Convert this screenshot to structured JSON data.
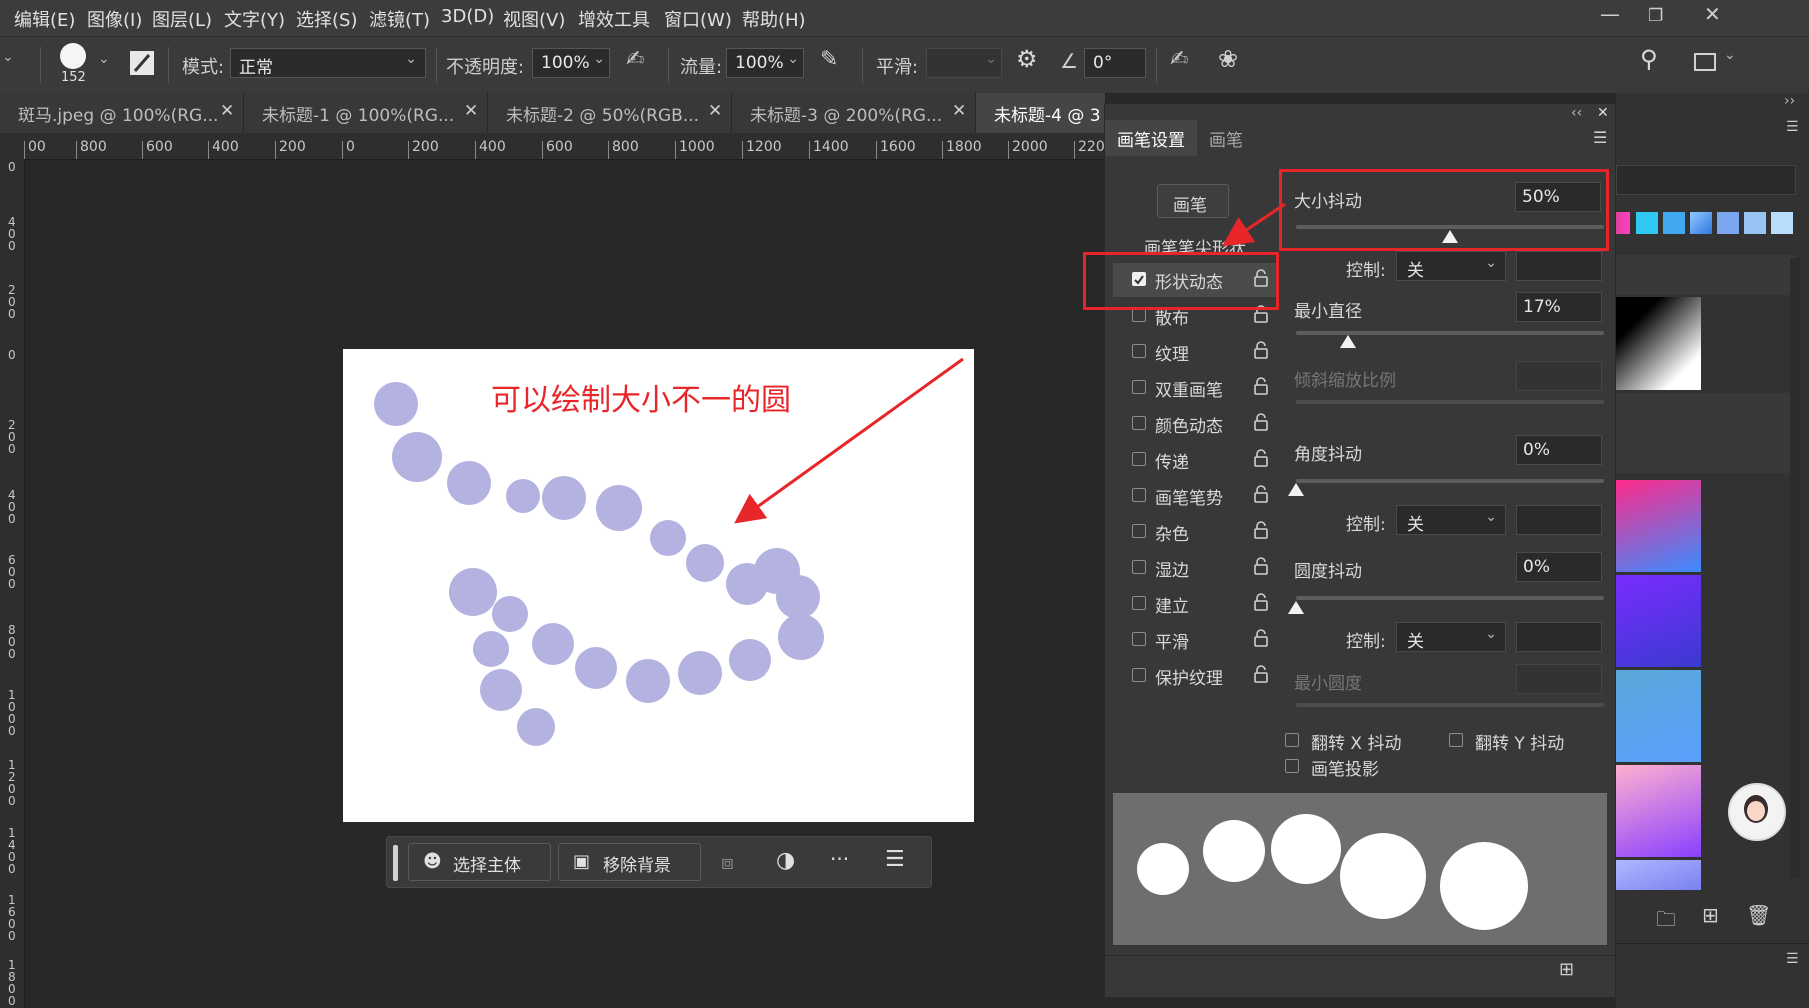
{
  "menu": {
    "items": [
      "编辑(E)",
      "图像(I)",
      "图层(L)",
      "文字(Y)",
      "选择(S)",
      "滤镜(T)",
      "3D(D)",
      "视图(V)",
      "增效工具",
      "窗口(W)",
      "帮助(H)"
    ]
  },
  "options": {
    "brush_size": "152",
    "mode_label": "模式:",
    "mode_value": "正常",
    "opacity_label": "不透明度:",
    "opacity_value": "100%",
    "flow_label": "流量:",
    "flow_value": "100%",
    "smoothing_label": "平滑:",
    "smoothing_value": "",
    "angle_value": "0°"
  },
  "tabs": [
    {
      "label": "斑马.jpeg @ 100%(RG..."
    },
    {
      "label": "未标题-1 @ 100%(RG..."
    },
    {
      "label": "未标题-2 @ 50%(RGB..."
    },
    {
      "label": "未标题-3 @ 200%(RG..."
    },
    {
      "label": "未标题-4 @ 3"
    }
  ],
  "ruler": {
    "h_ticks": [
      "00",
      "800",
      "600",
      "400",
      "200",
      "0",
      "200",
      "400",
      "600",
      "800",
      "1000",
      "1200",
      "1400",
      "1600",
      "1800",
      "2000",
      "220"
    ],
    "v_ticks": [
      "0",
      "400",
      "200",
      "0",
      "200",
      "400",
      "600",
      "800",
      "1000",
      "1200",
      "1400",
      "1600",
      "1800"
    ]
  },
  "canvas": {
    "annotation": "可以绘制大小不一的圆",
    "dot_color": "#b3b2e0",
    "annotation_color": "#e8262a"
  },
  "context_bar": {
    "select_subject": "选择主体",
    "remove_background": "移除背景",
    "more": "···"
  },
  "brush_panel": {
    "tab_settings": "画笔设置",
    "tab_brush": "画笔",
    "brush_button": "画笔",
    "tip_shape": "画笔笔尖形状",
    "list": [
      {
        "label": "形状动态",
        "checked": true
      },
      {
        "label": "散布",
        "checked": false
      },
      {
        "label": "纹理",
        "checked": false
      },
      {
        "label": "双重画笔",
        "checked": false
      },
      {
        "label": "颜色动态",
        "checked": false
      },
      {
        "label": "传递",
        "checked": false
      },
      {
        "label": "画笔笔势",
        "checked": false
      },
      {
        "label": "杂色",
        "checked": false
      },
      {
        "label": "湿边",
        "checked": false
      },
      {
        "label": "建立",
        "checked": false
      },
      {
        "label": "平滑",
        "checked": false
      },
      {
        "label": "保护纹理",
        "checked": false
      }
    ],
    "size_jitter_label": "大小抖动",
    "size_jitter_value": "50%",
    "control_label": "控制:",
    "control_value": "关",
    "min_diameter_label": "最小直径",
    "min_diameter_value": "17%",
    "tilt_scale_label": "倾斜缩放比例",
    "angle_jitter_label": "角度抖动",
    "angle_jitter_value": "0%",
    "roundness_jitter_label": "圆度抖动",
    "roundness_jitter_value": "0%",
    "min_roundness_label": "最小圆度",
    "flip_x_label": "翻转 X 抖动",
    "flip_y_label": "翻转 Y 抖动",
    "brush_projection_label": "画笔投影",
    "sliders": {
      "size_jitter": 0.5,
      "min_diameter": 0.17,
      "angle_jitter": 0,
      "roundness_jitter": 0
    }
  }
}
